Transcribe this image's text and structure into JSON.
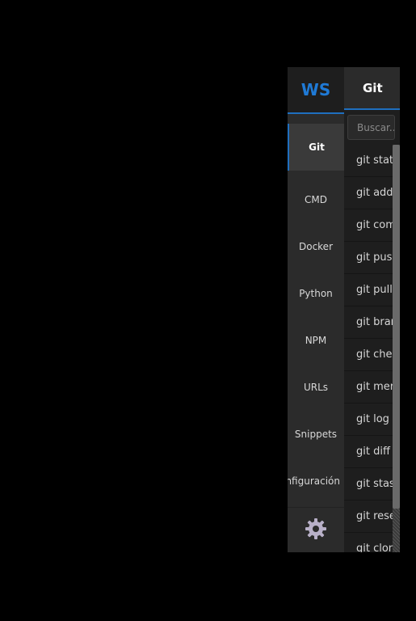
{
  "logo": {
    "text": "WS",
    "color": "#1f7ad6"
  },
  "sidebar": {
    "items": [
      {
        "label": "Git",
        "active": true
      },
      {
        "label": "CMD",
        "active": false
      },
      {
        "label": "Docker",
        "active": false
      },
      {
        "label": "Python",
        "active": false
      },
      {
        "label": "NPM",
        "active": false
      },
      {
        "label": "URLs",
        "active": false
      },
      {
        "label": "Snippets",
        "active": false
      },
      {
        "label": "Configuración",
        "active": false
      }
    ],
    "settings_icon": "gear-icon"
  },
  "panel": {
    "title": "Git",
    "search": {
      "placeholder": "Buscar...",
      "value": ""
    },
    "commands": [
      "git status",
      "git add",
      "git commit",
      "git push",
      "git pull",
      "git branch",
      "git checkout",
      "git merge",
      "git log",
      "git diff",
      "git stash",
      "git reset",
      "git clone"
    ]
  },
  "colors": {
    "accent": "#1f6fbf",
    "background": "#000000",
    "sidebar_bg": "#2b2b2b",
    "panel_bg": "#1e1e1e"
  }
}
